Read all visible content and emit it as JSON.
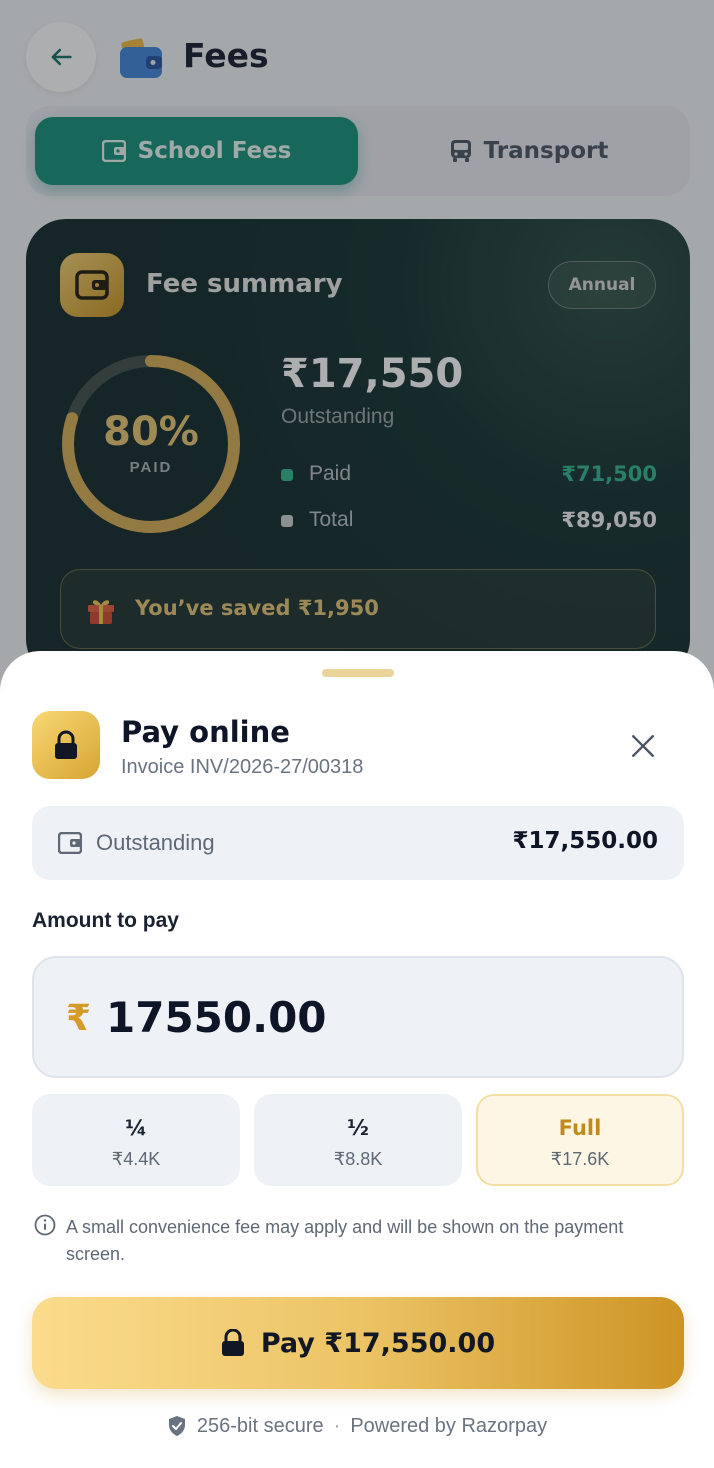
{
  "header": {
    "title": "Fees",
    "back_icon": "arrow-left-icon",
    "logo_icon": "wallet-icon"
  },
  "tabs": [
    {
      "label": "School Fees",
      "icon": "wallet-icon",
      "selected": true
    },
    {
      "label": "Transport",
      "icon": "bus-icon",
      "selected": false
    }
  ],
  "summary": {
    "title": "Fee summary",
    "period": "Annual",
    "paid_percent": 80,
    "percent_label": "80%",
    "paid_caption": "PAID",
    "outstanding_amount": "₹17,550",
    "outstanding_label": "Outstanding",
    "paid_label": "Paid",
    "paid_value": "₹71,500",
    "total_label": "Total",
    "total_value": "₹89,050",
    "saved_text": "You’ve saved ₹1,950"
  },
  "sheet": {
    "title": "Pay online",
    "invoice": "Invoice INV/2026-27/00318",
    "outstanding_label": "Outstanding",
    "outstanding_value": "₹17,550.00",
    "amount_label": "Amount to pay",
    "currency_symbol": "₹",
    "amount_value": "17550.00",
    "chips": [
      {
        "top": "¼",
        "bottom": "₹4.4K"
      },
      {
        "top": "½",
        "bottom": "₹8.8K"
      },
      {
        "top": "Full",
        "bottom": "₹17.6K"
      }
    ],
    "notice": "A small convenience fee may apply and will be shown on the payment screen.",
    "pay_button": "Pay ₹17,550.00",
    "secure_text": "256-bit secure",
    "separator": "·",
    "powered_text": "Powered by Razorpay"
  },
  "colors": {
    "accent_teal": "#0f8d77",
    "gold": "#d49b2a",
    "summary_bg": "#0a2224"
  }
}
